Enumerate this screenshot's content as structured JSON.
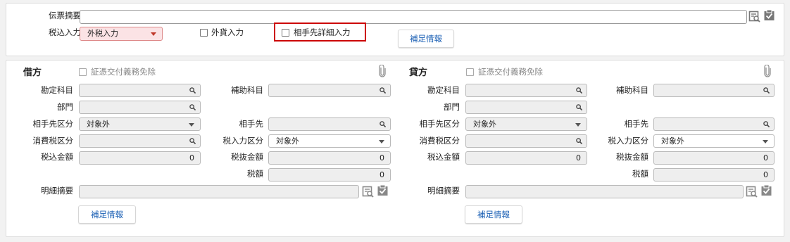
{
  "header": {
    "memo_label": "伝票摘要",
    "memo_value": "",
    "tax_input_label": "税込入力",
    "tax_input_select": "外税入力",
    "foreign_currency_label": "外貨入力",
    "partner_detail_label": "相手先詳細入力",
    "supplement_button": "補足情報"
  },
  "debit": {
    "title": "借方",
    "exemption_label": "証憑交付義務免除",
    "account_label": "勘定科目",
    "sub_account_label": "補助科目",
    "department_label": "部門",
    "partner_type_label": "相手先区分",
    "partner_type_value": "対象外",
    "partner_label": "相手先",
    "consumption_tax_label": "消費税区分",
    "tax_input_type_label": "税入力区分",
    "tax_input_type_value": "対象外",
    "tax_included_label": "税込金額",
    "tax_included_value": "0",
    "tax_excluded_label": "税抜金額",
    "tax_excluded_value": "0",
    "tax_amount_label": "税額",
    "tax_amount_value": "0",
    "detail_memo_label": "明細摘要",
    "supplement_button": "補足情報"
  },
  "credit": {
    "title": "貸方",
    "exemption_label": "証憑交付義務免除",
    "account_label": "勘定科目",
    "sub_account_label": "補助科目",
    "department_label": "部門",
    "partner_type_label": "相手先区分",
    "partner_type_value": "対象外",
    "partner_label": "相手先",
    "consumption_tax_label": "消費税区分",
    "tax_input_type_label": "税入力区分",
    "tax_input_type_value": "対象外",
    "tax_included_label": "税込金額",
    "tax_included_value": "0",
    "tax_excluded_label": "税抜金額",
    "tax_excluded_value": "0",
    "tax_amount_label": "税額",
    "tax_amount_value": "0",
    "detail_memo_label": "明細摘要",
    "supplement_button": "補足情報"
  },
  "colors": {
    "highlight": "#cc0000",
    "link_blue": "#1a5fb4",
    "select_pink": "#fbe3e5"
  }
}
